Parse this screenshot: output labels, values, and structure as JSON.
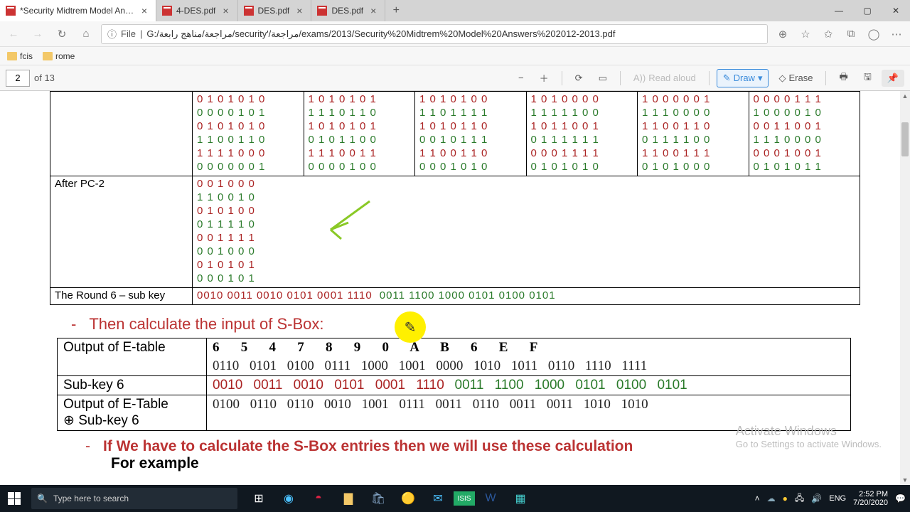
{
  "tabs": [
    {
      "title": "*Security Midtrem Model Answe",
      "active": true
    },
    {
      "title": "4-DES.pdf",
      "active": false
    },
    {
      "title": "DES.pdf",
      "active": false
    },
    {
      "title": "DES.pdf",
      "active": false
    }
  ],
  "url_file_label": "File",
  "url": "G:/مراجعة/مناهج رابعة/security'/مراجعة/exams/2013/Security%20Midtrem%20Model%20Answers%202012-2013.pdf",
  "bookmarks": [
    "fcis",
    "rome"
  ],
  "pdf": {
    "page": "2",
    "of": "of 13",
    "read_aloud": "Read aloud",
    "draw": "Draw",
    "erase": "Erase"
  },
  "top_bits_rows": [
    [
      "0 1 0 1 0 1 0",
      "1 0 1 0 1 0 1",
      "1 0 1 0 1 0 0",
      "1 0 1 0 0 0 0",
      "1 0 0 0 0 0 1",
      "0 0 0 0 1 1 1"
    ],
    [
      "0 0 0 0 1 0 1",
      "1 1 1 0 1 1 0",
      "1 1 0 1 1 1 1",
      "1 1 1 1 1 0 0",
      "1 1 1 0 0 0 0",
      "1 0 0 0 0 1 0"
    ],
    [
      "0 1 0 1 0 1 0",
      "1 0 1 0 1 0 1",
      "1 0 1 0 1 1 0",
      "1 0 1 1 0 0 1",
      "1 1 0 0 1 1 0",
      "0 0 1 1 0 0 1"
    ],
    [
      "1 1 0 0 1 1 0",
      "0 1 0 1 1 0 0",
      "0 0 1 0 1 1 1",
      "0 1 1 1 1 1 1",
      "0 1 1 1 1 0 0",
      "1 1 1 0 0 0 0"
    ],
    [
      "1 1 1 1 0 0 0",
      "1 1 1 0 0 1 1",
      "1 1 0 0 1 1 0",
      "0 0 0 1 1 1 1",
      "1 1 0 0 1 1 1",
      "0 0 0 1 0 0 1"
    ],
    [
      "0 0 0 0 0 0 1",
      "0 0 0 0 1 0 0",
      "0 0 0 1 0 1 0",
      "0 1 0 1 0 1 0",
      "0 1 0 1 0 0 0",
      "0 1 0 1 0 1 1"
    ]
  ],
  "after_pc2": {
    "label": "After PC-2",
    "lines": [
      "0 0 1 0 0 0",
      "1 1 0 0 1 0",
      "0 1 0 1 0 0",
      "0 1 1 1 1 0",
      "0 0 1 1 1 1",
      "0 0 1 0 0 0",
      "0 1 0 1 0 1",
      "0 0 0 1 0 1"
    ]
  },
  "round6": {
    "label": "The Round 6 – sub key",
    "red": "0010 0011 0010 0101 0001 1110",
    "green": "0011 1100 1000 0101 0100 0101"
  },
  "sbox_line": "Then calculate the input of S-Box:",
  "etable": {
    "row1_label": "Output of E-table",
    "row1_hex": "6   5   4   7   8   9   0   A   B   6   E   F",
    "row1_bits": "0110 0101 0100 0111 1000 1001 0000 1010 1011 0110 1110 1111",
    "row2_label": "Sub-key 6",
    "row2_red": "0010 0011 0010 0101 0001 1110",
    "row2_green": "0011 1100 1000 0101 0100 0101",
    "row3_label_a": "Output of E-Table",
    "row3_label_b": "⊕ Sub-key 6",
    "row3_bits": "0100 0110 0110 0010 1001 0111 0011 0110 0011 0011 1010 1010"
  },
  "ifline": "If We have to calculate the S-Box entries then we will use these calculation",
  "for_example": "For example",
  "activate": {
    "l1": "Activate Windows",
    "l2": "Go to Settings to activate Windows."
  },
  "search_placeholder": "Type here to search",
  "tray": {
    "lang": "ENG",
    "time": "2:52 PM",
    "date": "7/20/2020"
  }
}
